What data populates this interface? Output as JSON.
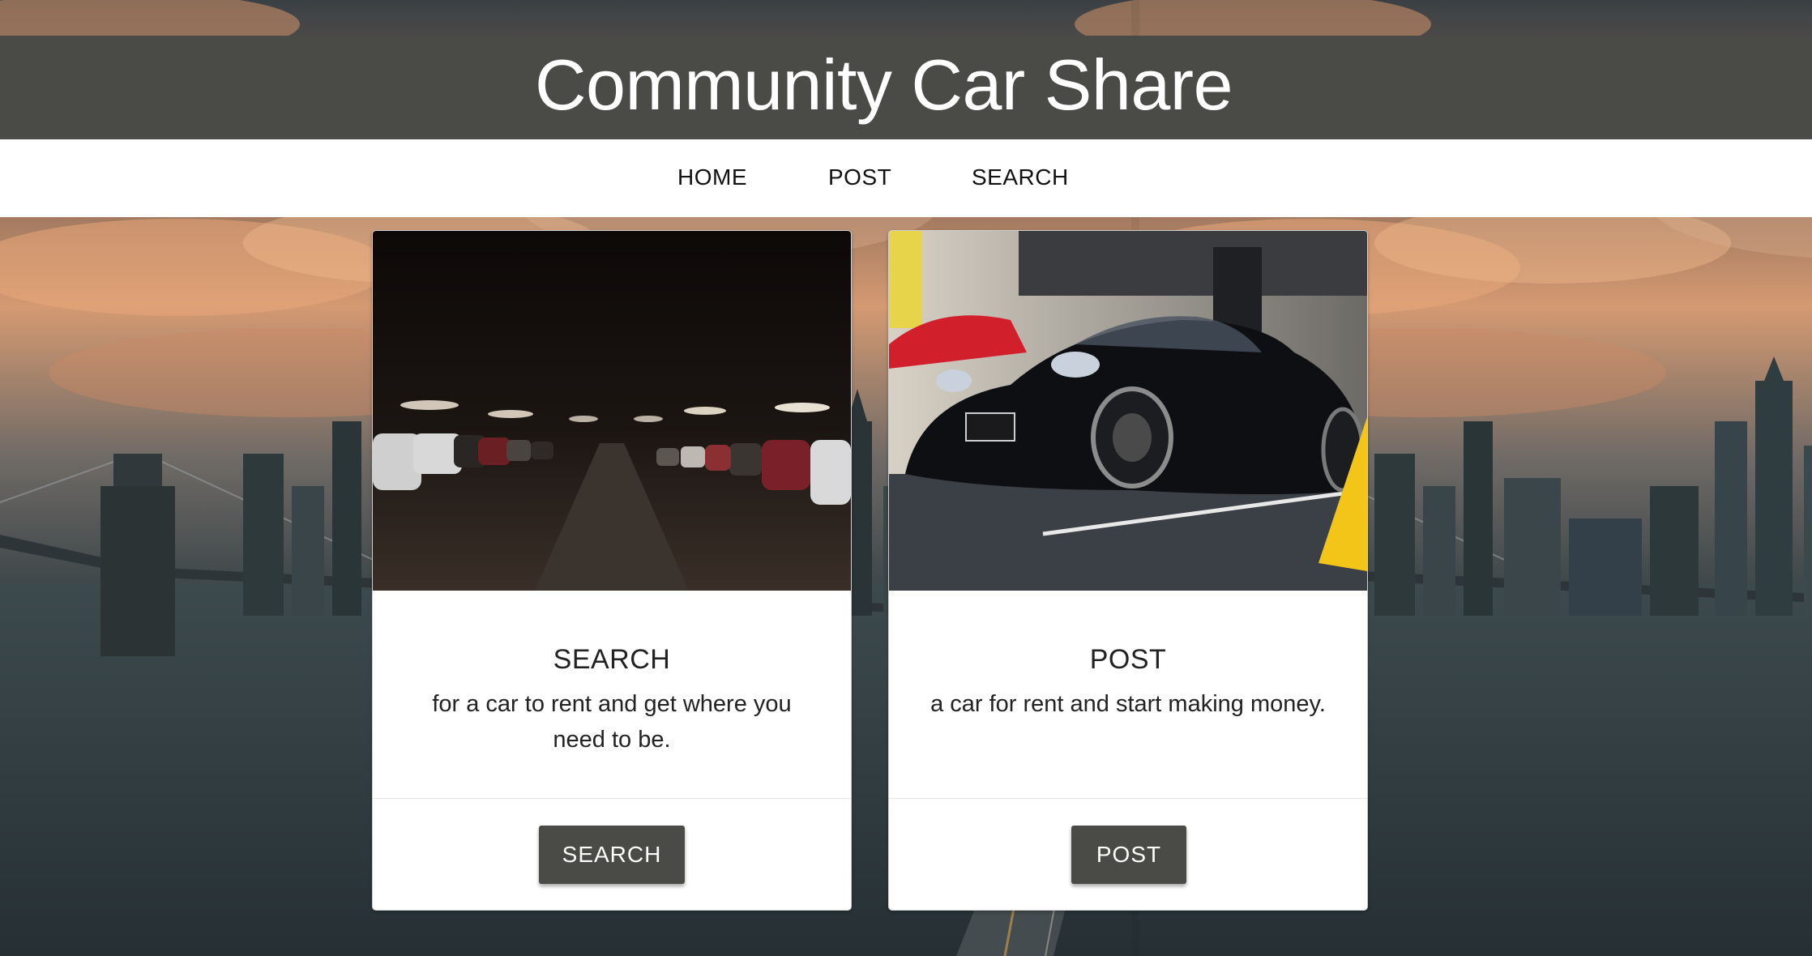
{
  "header": {
    "title": "Community Car Share"
  },
  "nav": {
    "items": [
      {
        "label": "HOME"
      },
      {
        "label": "POST"
      },
      {
        "label": "SEARCH"
      }
    ]
  },
  "cards": [
    {
      "title": "SEARCH",
      "text": "for a car to rent and get where you need to be.",
      "button": "SEARCH",
      "image": "parking-garage-photo"
    },
    {
      "title": "POST",
      "text": "a car for rent and start making money.",
      "button": "POST",
      "image": "black-sports-car-photo"
    }
  ],
  "colors": {
    "header_bg": "#4a4a46",
    "button_bg": "#4a4a46",
    "nav_bg": "#ffffff"
  }
}
